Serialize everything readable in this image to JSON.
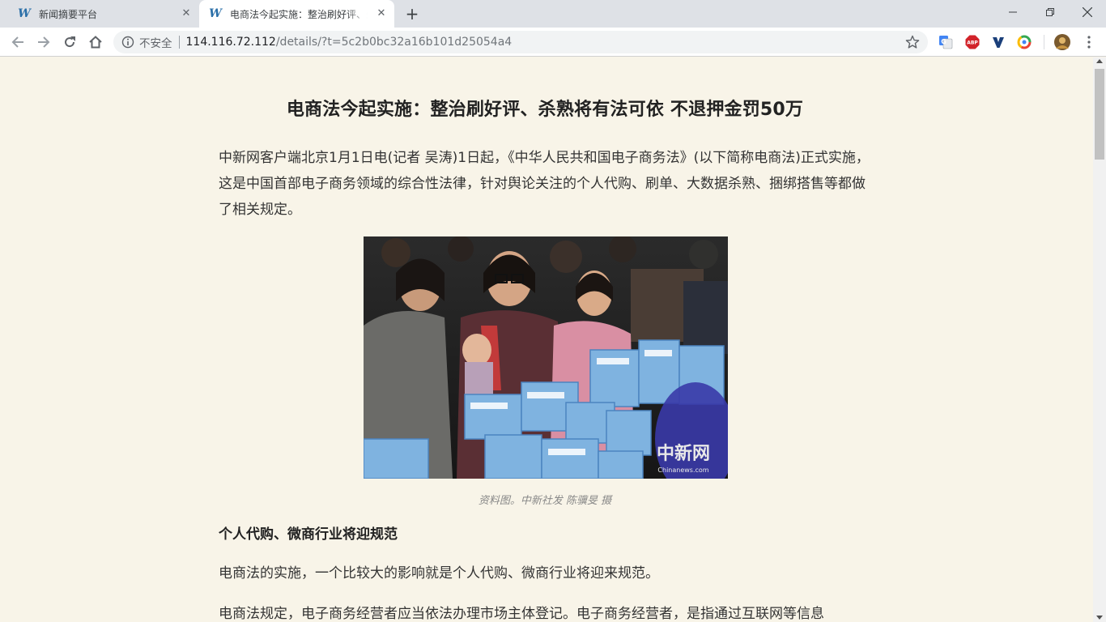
{
  "tabs": [
    {
      "favicon": "W",
      "title": "新闻摘要平台"
    },
    {
      "favicon": "W",
      "title": "电商法今起实施：整治刷好评、杀熟将有法可依 不退押金罚50万"
    }
  ],
  "toolbar": {
    "insecure_label": "不安全",
    "url_host": "114.116.72.112",
    "url_path": "/details/?t=5c2b0bc32a16b101d25054a4"
  },
  "extensions": {
    "abp_label": "ABP"
  },
  "article": {
    "headline": "电商法今起实施：整治刷好评、杀熟将有法可依 不退押金罚50万",
    "para1": "中新网客户端北京1月1日电(记者 吴涛)1日起，《中华人民共和国电子商务法》(以下简称电商法)正式实施，这是中国首部电子商务领域的综合性法律，针对舆论关注的个人代购、刷单、大数据杀熟、捆绑搭售等都做了相关规定。",
    "image_watermark": "中新网",
    "image_watermark_url": "Chinanews.com",
    "caption": "资料图。中新社发 陈骥旻 摄",
    "subhead": "个人代购、微商行业将迎规范",
    "para2": "电商法的实施，一个比较大的影响就是个人代购、微商行业将迎来规范。",
    "para3": "电商法规定，电子商务经营者应当依法办理市场主体登记。电子商务经营者，是指通过互联网等信息"
  },
  "colors": {
    "page_bg": "#f8f4e8",
    "tabstrip_bg": "#dee1e6",
    "text": "#333333"
  }
}
